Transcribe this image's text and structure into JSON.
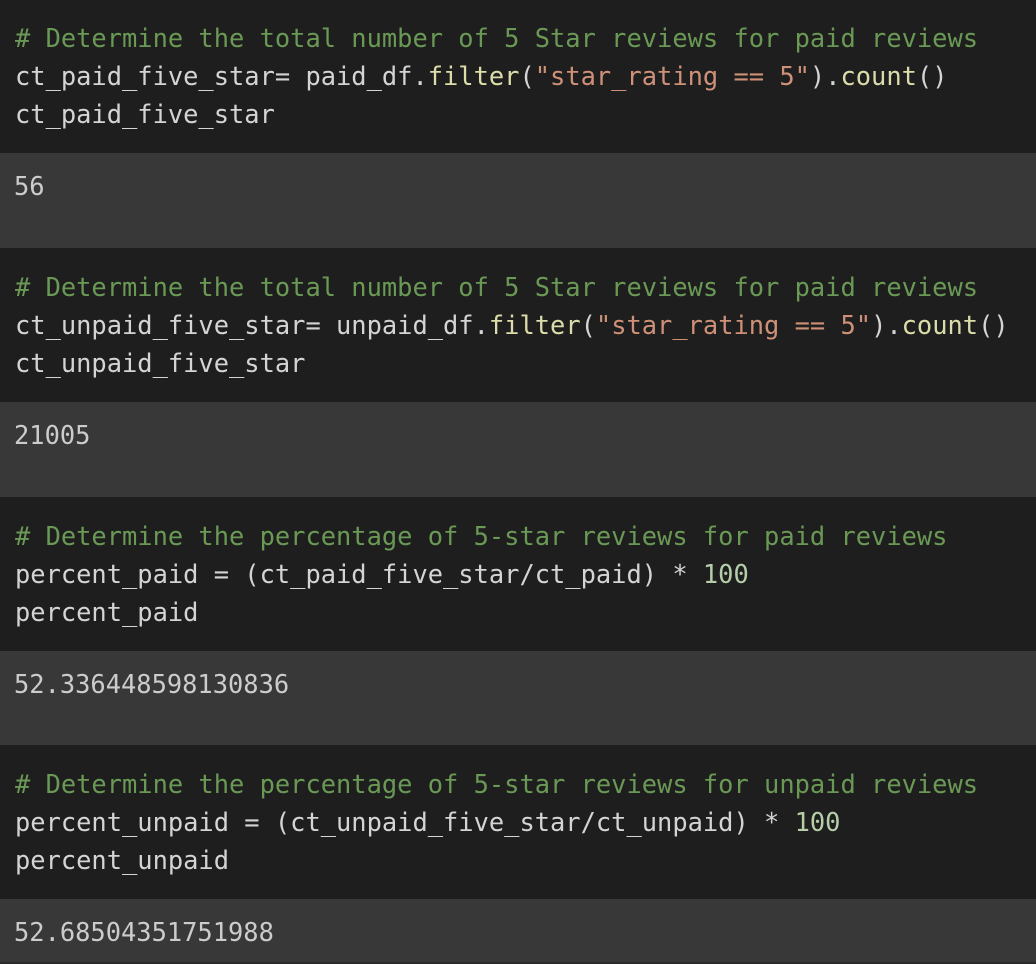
{
  "cells": [
    {
      "code": {
        "comment": "# Determine the total number of 5 Star reviews for paid reviews",
        "line2_a": "ct_paid_five_star= paid_df.",
        "line2_fn": "filter",
        "line2_b": "(",
        "line2_str": "\"star_rating == 5\"",
        "line2_c": ").",
        "line2_fn2": "count",
        "line2_d": "()",
        "line3": "ct_paid_five_star"
      },
      "output": "56"
    },
    {
      "code": {
        "comment": "# Determine the total number of 5 Star reviews for paid reviews",
        "line2_a": "ct_unpaid_five_star= unpaid_df.",
        "line2_fn": "filter",
        "line2_b": "(",
        "line2_str": "\"star_rating == 5\"",
        "line2_c": ").",
        "line2_fn2": "count",
        "line2_d": "()",
        "line3": "ct_unpaid_five_star"
      },
      "output": "21005"
    },
    {
      "code": {
        "comment": "# Determine the percentage of 5-star reviews for paid reviews",
        "line2_a": "percent_paid = (ct_paid_five_star/ct_paid) * ",
        "line2_num": "100",
        "line3": "percent_paid"
      },
      "output": "52.336448598130836"
    },
    {
      "code": {
        "comment": "# Determine the percentage of 5-star reviews for unpaid reviews",
        "line2_a": "percent_unpaid = (ct_unpaid_five_star/ct_unpaid) * ",
        "line2_num": "100",
        "line3": "percent_unpaid"
      },
      "output": "52.68504351751988"
    }
  ],
  "colors": {
    "background": "#1e1e1e",
    "output_background": "#383838",
    "comment": "#6a9955",
    "string": "#ce9178",
    "number": "#b5cea8",
    "function": "#dcdcaa",
    "text": "#d4d4d4"
  }
}
